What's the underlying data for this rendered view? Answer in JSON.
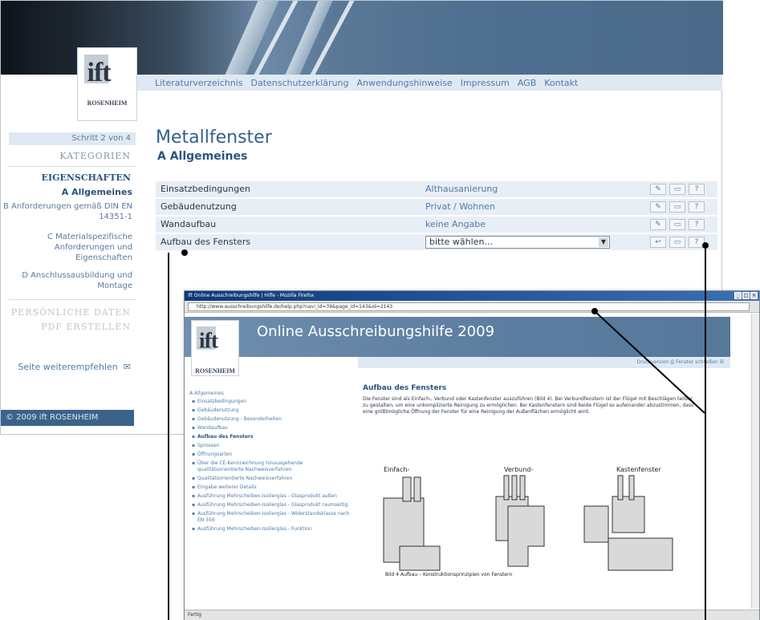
{
  "main": {
    "logo": {
      "text": "ift",
      "subtext": "ROSENHEIM"
    },
    "topnav": [
      "Literaturverzeichnis",
      "Datenschutzerklärung",
      "Anwendungshinweise",
      "Impressum",
      "AGB",
      "Kontakt"
    ],
    "sidebar": {
      "step": "Schritt 2 von 4",
      "kategorien": "KATEGORIEN",
      "eigenschaften": "EIGENSCHAFTEN",
      "items": [
        "A Allgemeines",
        "B Anforderungen gemäß DIN EN 14351-1",
        "C Materialspezifische Anforderungen und Eigenschaften",
        "D Anschlussausbildung und Montage"
      ],
      "persoenliche": "PERSÖNLICHE DATEN",
      "pdf": "PDF ERSTELLEN",
      "recommend": "Seite weiterempfehlen",
      "footer": "© 2009 ift ROSENHEIM"
    },
    "title": "Metallfenster",
    "subtitle": "A Allgemeines",
    "rows": [
      {
        "label": "Einsatzbedingungen",
        "value": "Althausanierung"
      },
      {
        "label": "Gebäudenutzung",
        "value": "Privat / Wohnen"
      },
      {
        "label": "Wandaufbau",
        "value": "keine Angabe"
      },
      {
        "label": "Aufbau des Fensters",
        "value": "bitte wählen..."
      }
    ],
    "buttons": {
      "edit": "✎",
      "comment": "▭",
      "help": "?",
      "back": "↩"
    }
  },
  "popup": {
    "window_title": "ift Online Ausschreibungshilfe | Hilfe - Mozilla Firefox",
    "url": "http://www.ausschreibungshilfe.de/help.php?navi_id=39&page_id=143&id=2143",
    "header_title": "Online Ausschreibungshilfe 2009",
    "links": "Druckversion ⎙   Fenster schließen ☒",
    "nav_head": "A Allgemeines",
    "nav_items": [
      "Einsatzbedingungen",
      "Gebäudenutzung",
      "Gebäudenutzung - Besonderheiten",
      "Wandaufbau",
      "Aufbau des Fensters",
      "Sprossen",
      "Öffnungsarten",
      "Über die CE-Kennzeichnung hinausgehende qualitätsorientierte Nachweisverfahren",
      "Qualitätsorientierte Nachweisverfahren",
      "Eingabe weiterer Details",
      "Ausführung Mehrscheiben-Isolierglas - Glasprodukt außen",
      "Ausführung Mehrscheiben-Isolierglas - Glasprodukt raumseitig",
      "Ausführung Mehrscheiben-Isolierglas - Widerstandsklasse nach EN 356",
      "Ausführung Mehrscheiben-Isolierglas - Funktion"
    ],
    "content_title": "Aufbau des Fensters",
    "content_text": "Die Fenster sind als Einfach-, Verbund oder Kastenfenster auszuführen (Bild 4). Bei Verbundfenstern ist der Flügel mit Beschlägen teilbar zu gestalten, um eine unkomplizierte Reinigung zu ermöglichen. Bei Kastenfenstern sind beide Flügel so aufeinander abzustimmen, dass eine größtmögliche Öffnung der Fenster für eine Reinigung der Außenflächen ermöglicht wird.",
    "fig_labels": [
      "Einfach-",
      "Verbund-",
      "Kastenfenster"
    ],
    "caption": "Bild 4  Aufbau – Konstruktionsprinzipien von Fenstern",
    "status": "Fertig"
  },
  "colors": {
    "accent": "#4f7ba7",
    "nav_bg": "#dfe9f3",
    "row_bg": "#e8eef5",
    "dark": "#2a5480"
  }
}
